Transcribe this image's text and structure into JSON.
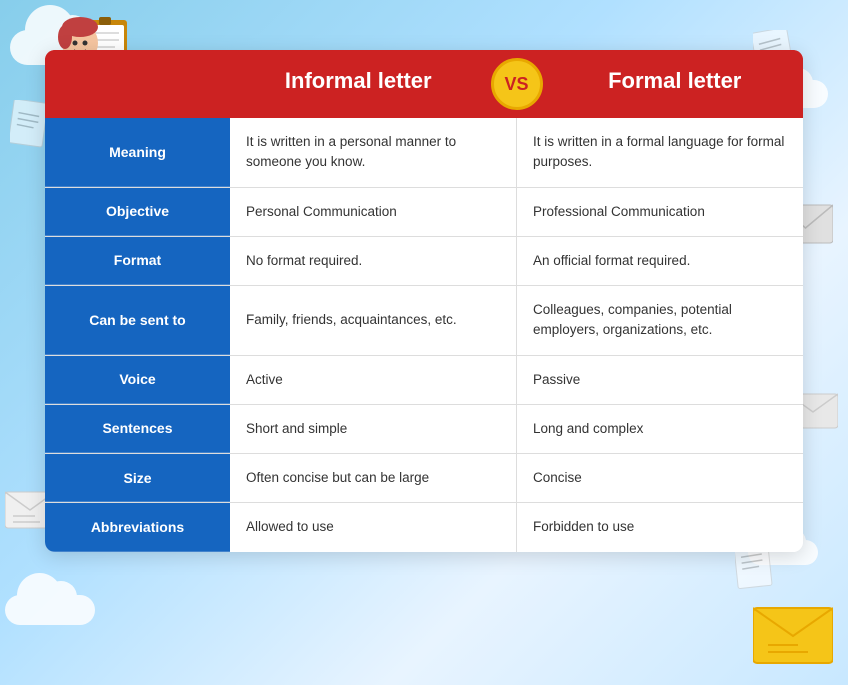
{
  "header": {
    "informal_label": "Informal letter",
    "vs_label": "VS",
    "formal_label": "Formal letter"
  },
  "rows": [
    {
      "label": "Meaning",
      "informal": "It is written in a personal manner to someone you know.",
      "formal": "It is written in a formal language for formal purposes."
    },
    {
      "label": "Objective",
      "informal": "Personal Communication",
      "formal": "Professional Communication"
    },
    {
      "label": "Format",
      "informal": "No format required.",
      "formal": "An official format required."
    },
    {
      "label": "Can be sent to",
      "informal": "Family, friends, acquaintances, etc.",
      "formal": "Colleagues, companies, potential employers, organizations, etc."
    },
    {
      "label": "Voice",
      "informal": "Active",
      "formal": "Passive"
    },
    {
      "label": "Sentences",
      "informal": "Short and simple",
      "formal": "Long and complex"
    },
    {
      "label": "Size",
      "informal": "Often concise but can be large",
      "formal": "Concise"
    },
    {
      "label": "Abbreviations",
      "informal": "Allowed to use",
      "formal": "Forbidden to use"
    }
  ]
}
